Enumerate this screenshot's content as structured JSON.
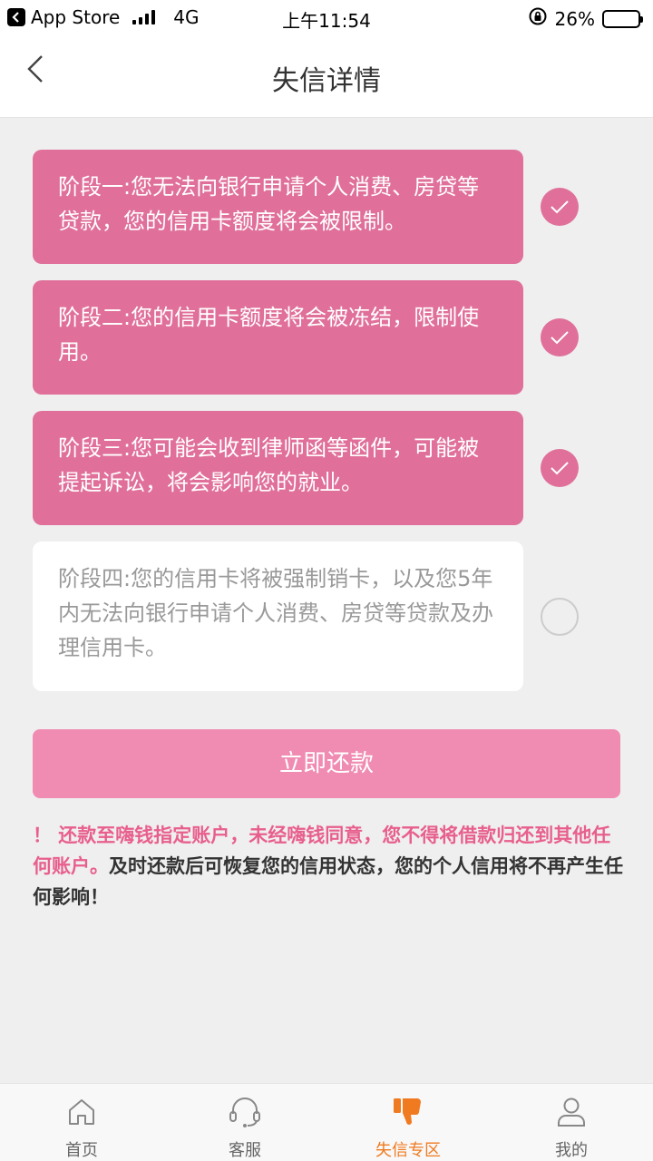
{
  "status_bar": {
    "back_app": "App Store",
    "network": "4G",
    "time": "上午11:54",
    "battery": "26%",
    "battery_level": 0.26
  },
  "nav": {
    "title": "失信详情"
  },
  "stages": [
    {
      "text": "阶段一:您无法向银行申请个人消费、房贷等贷款，您的信用卡额度将会被限制。",
      "completed": true
    },
    {
      "text": "阶段二:您的信用卡额度将会被冻结，限制使用。",
      "completed": true
    },
    {
      "text": "阶段三:您可能会收到律师函等函件，可能被提起诉讼，将会影响您的就业。",
      "completed": true
    },
    {
      "text": "阶段四:您的信用卡将被强制销卡，以及您5年内无法向银行申请个人消费、房贷等贷款及办理信用卡。",
      "completed": false
    }
  ],
  "repay_button": "立即还款",
  "notice": {
    "warning": "！ 还款至嗨钱指定账户，未经嗨钱同意，您不得将借款归还到其他任何账户。",
    "info": "及时还款后可恢复您的信用状态，您的个人信用将不再产生任何影响！"
  },
  "tabs": [
    {
      "label": "首页",
      "icon": "home-icon",
      "active": false
    },
    {
      "label": "客服",
      "icon": "headset-icon",
      "active": false
    },
    {
      "label": "失信专区",
      "icon": "thumbs-down-icon",
      "active": true
    },
    {
      "label": "我的",
      "icon": "user-icon",
      "active": false
    }
  ],
  "colors": {
    "accent_pink": "#e0709a",
    "button_pink": "#f08bb2",
    "warning_pink": "#e85f8c",
    "tab_active": "#f07a20"
  }
}
